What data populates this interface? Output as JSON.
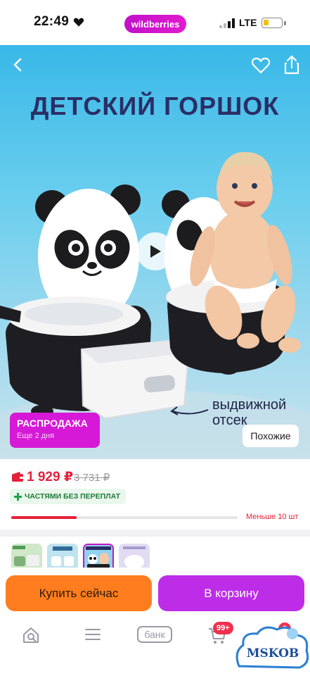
{
  "status_bar": {
    "time": "22:49",
    "network": "LTE",
    "brand": "wildberries"
  },
  "hero": {
    "title": "ДЕТСКИЙ ГОРШОК",
    "caption_line1": "выдвижной",
    "caption_line2": "отсек",
    "sale_title": "РАСПРОДАЖА",
    "sale_subtitle": "Еще 2 дня",
    "similar_label": "Похожие",
    "icons": [
      "back-arrow",
      "heart",
      "share",
      "play"
    ]
  },
  "price": {
    "current": "1 929 ₽",
    "old": "3 731 ₽",
    "installment_label": "ЧАСТЯМИ БЕЗ ПЕРЕПЛАТ",
    "stock_label": "Меньше 10 шт",
    "stock_level_percent": 29
  },
  "thumbnails": {
    "count": 4,
    "selected_index": 2,
    "third_caption": "ДЕТСКИЙ ГОРШОК"
  },
  "actions": {
    "buy_now": "Купить сейчас",
    "add_to_cart": "В корзину"
  },
  "bottom_nav": {
    "bank_label": "банк",
    "cart_badge": "99+",
    "profile_badge": "2"
  },
  "watermark": {
    "text": "MSKOB"
  },
  "colors": {
    "brand_purple": "#cb11ab",
    "price_red": "#e5213b",
    "buy_orange": "#ff7d1e",
    "cart_purple": "#bd2de8",
    "sale_magenta": "#d619d6",
    "installment_green": "#1f7a3a"
  }
}
